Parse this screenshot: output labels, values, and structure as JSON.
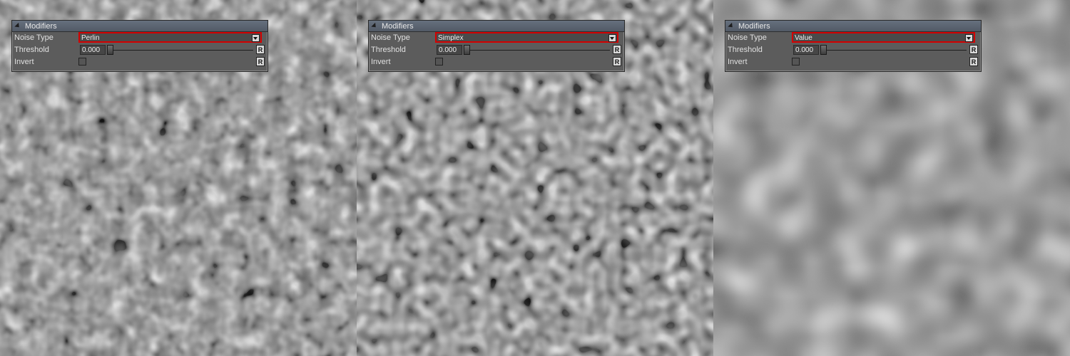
{
  "panels": [
    {
      "header": "Modifiers",
      "noise_type": {
        "label": "Noise Type",
        "value": "Perlin"
      },
      "threshold": {
        "label": "Threshold",
        "value": "0.000"
      },
      "invert": {
        "label": "Invert",
        "checked": false
      },
      "reset_label": "R"
    },
    {
      "header": "Modifiers",
      "noise_type": {
        "label": "Noise Type",
        "value": "Simplex"
      },
      "threshold": {
        "label": "Threshold",
        "value": "0.000"
      },
      "invert": {
        "label": "Invert",
        "checked": false
      },
      "reset_label": "R"
    },
    {
      "header": "Modifiers",
      "noise_type": {
        "label": "Noise Type",
        "value": "Value"
      },
      "threshold": {
        "label": "Threshold",
        "value": "0.000"
      },
      "invert": {
        "label": "Invert",
        "checked": false
      },
      "reset_label": "R"
    }
  ],
  "colors": {
    "highlight": "#d40000"
  }
}
